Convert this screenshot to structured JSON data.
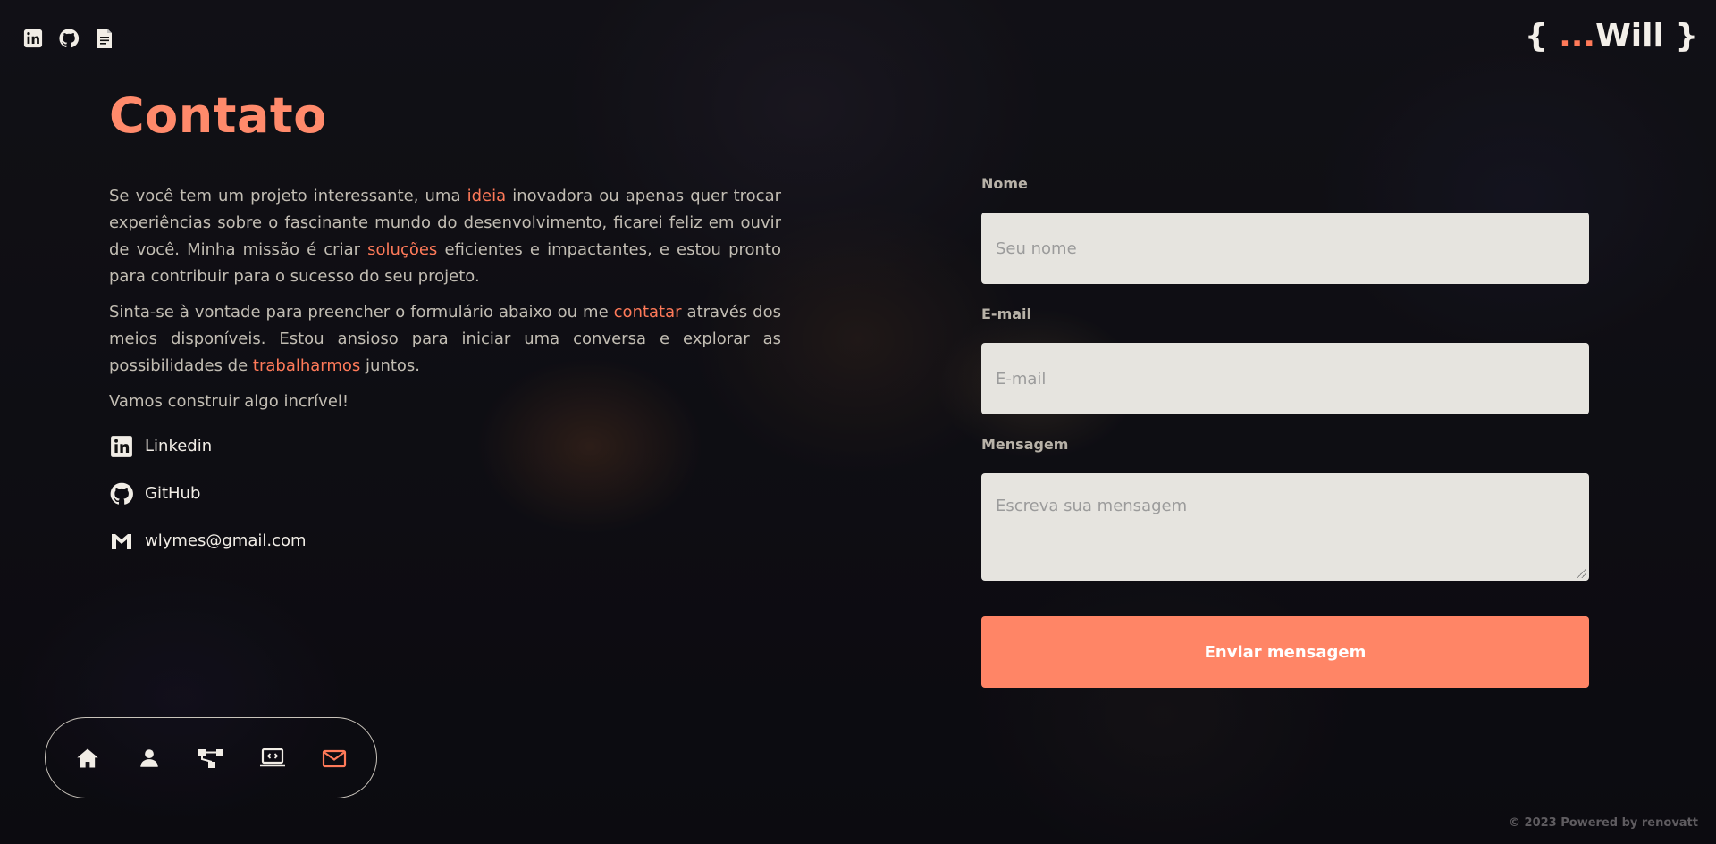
{
  "brand": {
    "open": "{ ",
    "dots": "...",
    "name": "Will",
    "close": " }"
  },
  "top_icons": [
    "linkedin-icon",
    "github-icon",
    "document-icon"
  ],
  "contact": {
    "title": "Contato",
    "p1": {
      "a": "Se você tem um projeto interessante, uma ",
      "h1": "ideia",
      "b": " inovadora ou apenas quer trocar experiências sobre o fascinante mundo do desenvolvimento, ficarei feliz em ouvir de você. Minha missão é criar ",
      "h2": "soluções",
      "c": " eficientes e impactantes, e estou pronto para contribuir para o sucesso do seu projeto."
    },
    "p2": {
      "a": "Sinta-se à vontade para preencher o formulário abaixo ou me ",
      "h1": "contatar",
      "b": " através dos meios disponíveis. Estou ansioso para iniciar uma conversa e explorar as possibilidades de ",
      "h2": "trabalharmos",
      "c": " juntos."
    },
    "closing": "Vamos construir algo incrível!",
    "links": [
      {
        "label": "Linkedin",
        "icon": "linkedin-icon"
      },
      {
        "label": "GitHub",
        "icon": "github-icon"
      },
      {
        "label": "wlymes@gmail.com",
        "icon": "gmail-icon"
      }
    ]
  },
  "form": {
    "name_label": "Nome",
    "name_placeholder": "Seu nome",
    "email_label": "E-mail",
    "email_placeholder": "E-mail",
    "message_label": "Mensagem",
    "message_placeholder": "Escreva sua mensagem",
    "submit_label": "Enviar mensagem"
  },
  "dock": {
    "items": [
      "home-icon",
      "user-icon",
      "skills-icon",
      "projects-icon",
      "mail-icon"
    ],
    "active": "mail-icon"
  },
  "footer": "© 2023 Powered by renovatt",
  "colors": {
    "accent": "#ff7a59",
    "button": "#ff8566",
    "field_bg": "#e6e4df"
  }
}
